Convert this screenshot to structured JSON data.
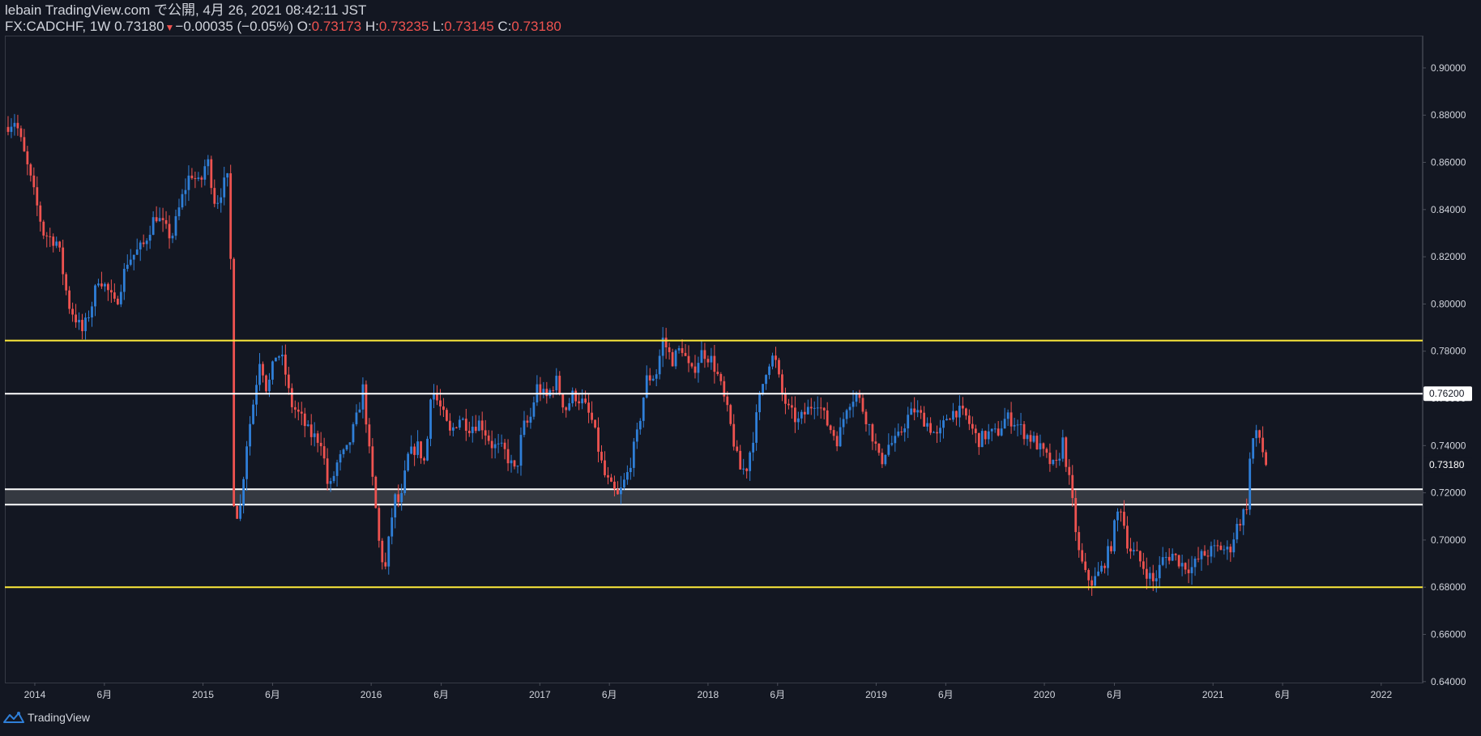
{
  "header": {
    "publisher_line": "lebain TradingView.com で公開, 4月 26, 2021 08:42:11 JST",
    "symbol_tf": "FX:CADCHF, 1W",
    "last_price": "0.73180",
    "change_arrow": "▼",
    "change": "−0.00035 (−0.05%)",
    "o_label": "O:",
    "o_value": "0.73173",
    "h_label": "H:",
    "h_value": "0.73235",
    "l_label": "L:",
    "l_value": "0.73145",
    "c_label": "C:",
    "c_value": "0.73180"
  },
  "footer": {
    "brand": "TradingView",
    "logo_icon": "tradingview-logo-icon"
  },
  "colors": {
    "background": "#131722",
    "up": "#2f7fd8",
    "down": "#ef5350",
    "yellow_line": "#ffeb3b",
    "white_line": "#ffffff",
    "zone_fill": "#3a3d45",
    "axis_text": "#d1d4dc",
    "axis_line": "#363a45"
  },
  "chart_data": {
    "type": "candlestick",
    "symbol": "FX:CADCHF",
    "timeframe": "1W",
    "x_tick_labels": [
      {
        "label": "2014",
        "x": "2014-01-01"
      },
      {
        "label": "6月",
        "x": "2014-06-01"
      },
      {
        "label": "2015",
        "x": "2015-01-01"
      },
      {
        "label": "6月",
        "x": "2015-06-01"
      },
      {
        "label": "2016",
        "x": "2016-01-01"
      },
      {
        "label": "6月",
        "x": "2016-06-01"
      },
      {
        "label": "2017",
        "x": "2017-01-01"
      },
      {
        "label": "6月",
        "x": "2017-06-01"
      },
      {
        "label": "2018",
        "x": "2018-01-01"
      },
      {
        "label": "6月",
        "x": "2018-06-01"
      },
      {
        "label": "2019",
        "x": "2019-01-01"
      },
      {
        "label": "6月",
        "x": "2019-06-01"
      },
      {
        "label": "2020",
        "x": "2020-01-01"
      },
      {
        "label": "6月",
        "x": "2020-06-01"
      },
      {
        "label": "2021",
        "x": "2021-01-01"
      },
      {
        "label": "6月",
        "x": "2021-06-01"
      },
      {
        "label": "2022",
        "x": "2022-01-01"
      }
    ],
    "y_ticks": [
      "0.64000",
      "0.66000",
      "0.68000",
      "0.70000",
      "0.72000",
      "0.74000",
      "0.76000",
      "0.78000",
      "0.80000",
      "0.82000",
      "0.84000",
      "0.86000",
      "0.88000",
      "0.90000"
    ],
    "y_range": [
      0.6396,
      0.9137
    ],
    "x_range": [
      "2013-10-28",
      "2022-04-01"
    ],
    "horizontal_lines": [
      {
        "price": 0.7845,
        "color": "yellow"
      },
      {
        "price": 0.762,
        "color": "white",
        "label": "0.76200"
      },
      {
        "price": 0.68,
        "color": "yellow"
      }
    ],
    "zone": {
      "top": 0.7215,
      "bottom": 0.715
    },
    "last_price_label": "0.73180",
    "anchors": [
      [
        "2013-10-28",
        0.875
      ],
      [
        "2013-11-20",
        0.878
      ],
      [
        "2013-12-20",
        0.855
      ],
      [
        "2014-01-20",
        0.83
      ],
      [
        "2014-02-20",
        0.826
      ],
      [
        "2014-03-15",
        0.8
      ],
      [
        "2014-04-15",
        0.788
      ],
      [
        "2014-05-05",
        0.8
      ],
      [
        "2014-05-20",
        0.812
      ],
      [
        "2014-06-10",
        0.805
      ],
      [
        "2014-06-25",
        0.799
      ],
      [
        "2014-07-20",
        0.818
      ],
      [
        "2014-08-25",
        0.825
      ],
      [
        "2014-09-20",
        0.838
      ],
      [
        "2014-10-10",
        0.832
      ],
      [
        "2014-10-25",
        0.828
      ],
      [
        "2014-11-15",
        0.844
      ],
      [
        "2014-12-05",
        0.856
      ],
      [
        "2014-12-25",
        0.85
      ],
      [
        "2015-01-10",
        0.862
      ],
      [
        "2015-01-28",
        0.842
      ],
      [
        "2015-02-20",
        0.853
      ],
      [
        "2015-02-28",
        0.852
      ],
      [
        "2015-03-08",
        0.718
      ],
      [
        "2015-03-20",
        0.708
      ],
      [
        "2015-04-05",
        0.74
      ],
      [
        "2015-04-20",
        0.758
      ],
      [
        "2015-05-05",
        0.778
      ],
      [
        "2015-05-20",
        0.763
      ],
      [
        "2015-06-10",
        0.78
      ],
      [
        "2015-06-25",
        0.775
      ],
      [
        "2015-07-10",
        0.758
      ],
      [
        "2015-08-01",
        0.752
      ],
      [
        "2015-08-20",
        0.745
      ],
      [
        "2015-09-15",
        0.742
      ],
      [
        "2015-10-01",
        0.72
      ],
      [
        "2015-10-20",
        0.733
      ],
      [
        "2015-11-10",
        0.738
      ],
      [
        "2015-12-01",
        0.752
      ],
      [
        "2015-12-15",
        0.765
      ],
      [
        "2015-12-25",
        0.742
      ],
      [
        "2016-01-10",
        0.715
      ],
      [
        "2016-01-20",
        0.695
      ],
      [
        "2016-02-01",
        0.688
      ],
      [
        "2016-02-20",
        0.718
      ],
      [
        "2016-03-05",
        0.715
      ],
      [
        "2016-03-20",
        0.735
      ],
      [
        "2016-04-10",
        0.74
      ],
      [
        "2016-04-28",
        0.732
      ],
      [
        "2016-05-10",
        0.765
      ],
      [
        "2016-06-01",
        0.755
      ],
      [
        "2016-06-20",
        0.745
      ],
      [
        "2016-07-10",
        0.752
      ],
      [
        "2016-08-01",
        0.748
      ],
      [
        "2016-08-25",
        0.75
      ],
      [
        "2016-09-20",
        0.74
      ],
      [
        "2016-10-15",
        0.738
      ],
      [
        "2016-11-10",
        0.728
      ],
      [
        "2016-11-25",
        0.748
      ],
      [
        "2016-12-10",
        0.75
      ],
      [
        "2016-12-25",
        0.765
      ],
      [
        "2017-01-15",
        0.76
      ],
      [
        "2017-02-05",
        0.768
      ],
      [
        "2017-02-25",
        0.755
      ],
      [
        "2017-03-15",
        0.762
      ],
      [
        "2017-04-05",
        0.758
      ],
      [
        "2017-04-25",
        0.75
      ],
      [
        "2017-05-20",
        0.728
      ],
      [
        "2017-06-05",
        0.722
      ],
      [
        "2017-06-20",
        0.718
      ],
      [
        "2017-07-10",
        0.728
      ],
      [
        "2017-08-01",
        0.745
      ],
      [
        "2017-08-20",
        0.768
      ],
      [
        "2017-09-10",
        0.77
      ],
      [
        "2017-09-25",
        0.785
      ],
      [
        "2017-10-15",
        0.776
      ],
      [
        "2017-11-05",
        0.782
      ],
      [
        "2017-11-25",
        0.77
      ],
      [
        "2017-12-20",
        0.78
      ],
      [
        "2018-01-10",
        0.776
      ],
      [
        "2018-01-25",
        0.768
      ],
      [
        "2018-02-15",
        0.752
      ],
      [
        "2018-03-10",
        0.73
      ],
      [
        "2018-03-25",
        0.73
      ],
      [
        "2018-04-10",
        0.745
      ],
      [
        "2018-04-25",
        0.762
      ],
      [
        "2018-05-10",
        0.775
      ],
      [
        "2018-05-25",
        0.778
      ],
      [
        "2018-06-10",
        0.762
      ],
      [
        "2018-06-25",
        0.755
      ],
      [
        "2018-07-15",
        0.75
      ],
      [
        "2018-08-05",
        0.755
      ],
      [
        "2018-08-25",
        0.76
      ],
      [
        "2018-09-15",
        0.75
      ],
      [
        "2018-10-10",
        0.742
      ],
      [
        "2018-10-30",
        0.758
      ],
      [
        "2018-11-20",
        0.762
      ],
      [
        "2018-12-10",
        0.752
      ],
      [
        "2018-12-28",
        0.742
      ],
      [
        "2019-01-10",
        0.732
      ],
      [
        "2019-01-25",
        0.74
      ],
      [
        "2019-02-15",
        0.742
      ],
      [
        "2019-03-10",
        0.752
      ],
      [
        "2019-03-25",
        0.755
      ],
      [
        "2019-04-20",
        0.75
      ],
      [
        "2019-05-15",
        0.743
      ],
      [
        "2019-06-05",
        0.753
      ],
      [
        "2019-06-25",
        0.755
      ],
      [
        "2019-07-15",
        0.752
      ],
      [
        "2019-08-10",
        0.742
      ],
      [
        "2019-08-30",
        0.745
      ],
      [
        "2019-09-20",
        0.745
      ],
      [
        "2019-10-10",
        0.752
      ],
      [
        "2019-10-30",
        0.75
      ],
      [
        "2019-11-20",
        0.745
      ],
      [
        "2019-12-10",
        0.742
      ],
      [
        "2020-01-05",
        0.735
      ],
      [
        "2020-01-25",
        0.73
      ],
      [
        "2020-02-10",
        0.742
      ],
      [
        "2020-02-28",
        0.72
      ],
      [
        "2020-03-15",
        0.695
      ],
      [
        "2020-03-30",
        0.685
      ],
      [
        "2020-04-15",
        0.682
      ],
      [
        "2020-05-05",
        0.688
      ],
      [
        "2020-05-25",
        0.698
      ],
      [
        "2020-06-05",
        0.71
      ],
      [
        "2020-06-15",
        0.714
      ],
      [
        "2020-07-01",
        0.697
      ],
      [
        "2020-07-20",
        0.693
      ],
      [
        "2020-08-05",
        0.688
      ],
      [
        "2020-08-25",
        0.682
      ],
      [
        "2020-09-15",
        0.692
      ],
      [
        "2020-10-05",
        0.694
      ],
      [
        "2020-10-25",
        0.69
      ],
      [
        "2020-11-15",
        0.688
      ],
      [
        "2020-12-05",
        0.693
      ],
      [
        "2020-12-25",
        0.695
      ],
      [
        "2021-01-15",
        0.697
      ],
      [
        "2021-02-05",
        0.695
      ],
      [
        "2021-02-20",
        0.705
      ],
      [
        "2021-03-05",
        0.71
      ],
      [
        "2021-03-15",
        0.715
      ],
      [
        "2021-03-25",
        0.742
      ],
      [
        "2021-04-10",
        0.745
      ],
      [
        "2021-04-16",
        0.74
      ],
      [
        "2021-04-26",
        0.7318
      ]
    ]
  }
}
